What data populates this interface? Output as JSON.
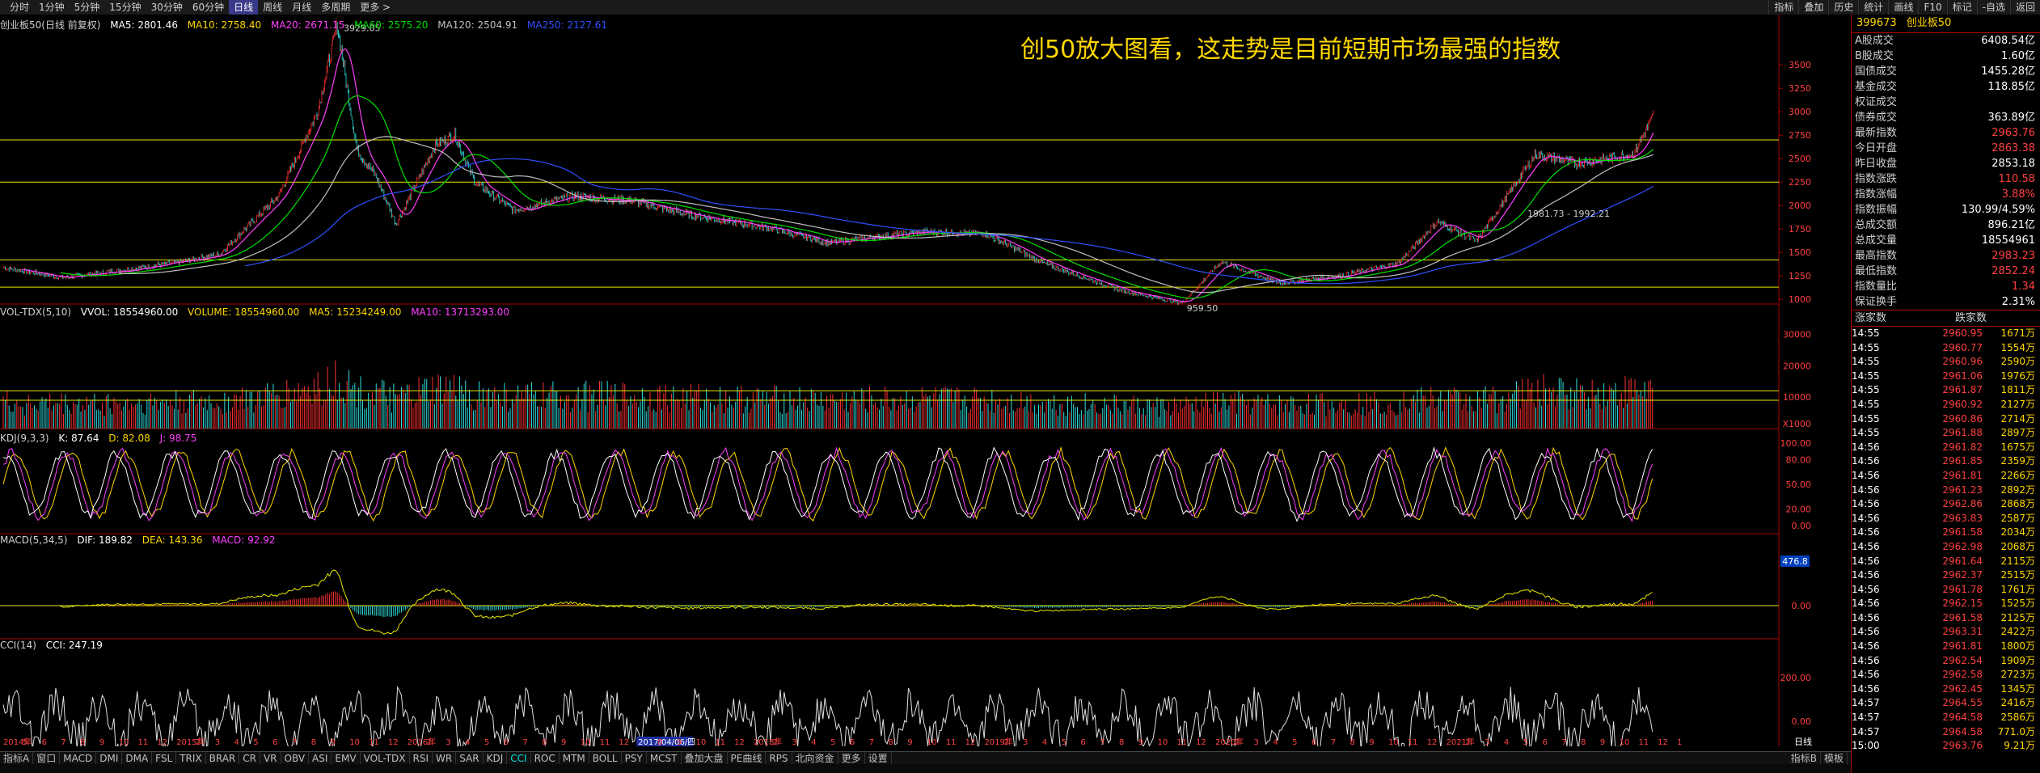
{
  "toolbar": {
    "items": [
      "分时",
      "1分钟",
      "5分钟",
      "15分钟",
      "30分钟",
      "60分钟",
      "日线",
      "周线",
      "月线",
      "多周期",
      "更多 >"
    ],
    "active": "日线",
    "right_items": [
      "指标",
      "叠加",
      "历史",
      "统计",
      "画线",
      "F10",
      "标记",
      "-自选",
      "返回"
    ]
  },
  "main_legend": {
    "name": "创业板50(日线 前复权)",
    "ma5": "MA5: 2801.46",
    "ma10": "MA10: 2758.40",
    "ma20": "MA20: 2671.15",
    "ma60": "MA60: 2575.20",
    "ma120": "MA120: 2504.91",
    "ma250": "MA250: 2127.61"
  },
  "overlay_title": "创50放大图看，这走势是目前短期市场最强的指数",
  "annotations": {
    "peak": "3929.05",
    "low": "959.50",
    "range": "1981.73 - 1992.21"
  },
  "vol_legend": {
    "name": "VOL-TDX(5,10)",
    "vvol": "VVOL: 18554960.00",
    "volume": "VOLUME: 18554960.00",
    "ma5": "MA5: 15234249.00",
    "ma10": "MA10: 13713293.00",
    "unit": "X1000"
  },
  "kdj_legend": {
    "name": "KDJ(9,3,3)",
    "k": "K: 87.64",
    "d": "D: 82.08",
    "j": "J: 98.75"
  },
  "macd_legend": {
    "name": "MACD(5,34,5)",
    "dif": "DIF: 189.82",
    "dea": "DEA: 143.36",
    "macd": "MACD: 92.92",
    "current": "476.8"
  },
  "cci_legend": {
    "name": "CCI(14)",
    "cci": "CCI: 247.19"
  },
  "axes": {
    "price_ticks": [
      "3500",
      "3250",
      "3000",
      "2750",
      "2500",
      "2250",
      "2000",
      "1750",
      "1500",
      "1250",
      "1000"
    ],
    "vol_ticks": [
      "30000",
      "20000",
      "10000"
    ],
    "kdj_ticks": [
      "100.00",
      "80.00",
      "50.00",
      "20.00",
      "0.00"
    ],
    "macd_ticks": [
      "0.00"
    ],
    "cci_ticks": [
      "200.00",
      "0.00"
    ],
    "date_labels": [
      "2014年",
      "5",
      "6",
      "7",
      "8",
      "9",
      "10",
      "11",
      "12",
      "2015年",
      "2",
      "3",
      "4",
      "5",
      "6",
      "7",
      "8",
      "9",
      "10",
      "11",
      "12",
      "2016年",
      "2",
      "3",
      "4",
      "5",
      "6",
      "7",
      "8",
      "9",
      "10",
      "11",
      "12",
      "2017/04/06/四",
      "8",
      "9",
      "10",
      "11",
      "12",
      "2018年",
      "2",
      "3",
      "4",
      "5",
      "6",
      "7",
      "8",
      "9",
      "10",
      "11",
      "12",
      "2019年",
      "2",
      "3",
      "4",
      "5",
      "6",
      "7",
      "8",
      "9",
      "10",
      "11",
      "12",
      "2020年",
      "2",
      "3",
      "4",
      "5",
      "6",
      "7",
      "8",
      "9",
      "10",
      "11",
      "12",
      "2021年",
      "2",
      "3",
      "4",
      "5",
      "6",
      "7",
      "8",
      "9",
      "10",
      "11",
      "12",
      "1"
    ],
    "date_right": "日线"
  },
  "bottom_tabs": [
    "指标A",
    "窗口",
    "MACD",
    "DMI",
    "DMA",
    "FSL",
    "TRIX",
    "BRAR",
    "CR",
    "VR",
    "OBV",
    "ASI",
    "EMV",
    "VOL-TDX",
    "RSI",
    "WR",
    "SAR",
    "KDJ",
    "CCI",
    "ROC",
    "MTM",
    "BOLL",
    "PSY",
    "MCST",
    "叠加大盘",
    "PE曲线",
    "RPS",
    "北向资金",
    "更多",
    "设置"
  ],
  "bottom_right": [
    "指标B",
    "模板"
  ],
  "panel": {
    "code": "399673",
    "name": "创业板50",
    "stats": [
      {
        "label": "A股成交",
        "value": "6408.54亿",
        "color": "white"
      },
      {
        "label": "B股成交",
        "value": "1.60亿",
        "color": "white"
      },
      {
        "label": "国债成交",
        "value": "1455.28亿",
        "color": "white"
      },
      {
        "label": "基金成交",
        "value": "118.85亿",
        "color": "white"
      },
      {
        "label": "权证成交",
        "value": "",
        "color": "white"
      },
      {
        "label": "债券成交",
        "value": "363.89亿",
        "color": "white"
      },
      {
        "label": "最新指数",
        "value": "2963.76",
        "color": "red"
      },
      {
        "label": "今日开盘",
        "value": "2863.38",
        "color": "red"
      },
      {
        "label": "昨日收盘",
        "value": "2853.18",
        "color": "white"
      },
      {
        "label": "指数涨跌",
        "value": "110.58",
        "color": "red"
      },
      {
        "label": "指数涨幅",
        "value": "3.88%",
        "color": "red"
      },
      {
        "label": "指数振幅",
        "value": "130.99/4.59%",
        "color": "white"
      },
      {
        "label": "总成交额",
        "value": "896.21亿",
        "color": "white"
      },
      {
        "label": "总成交量",
        "value": "18554961",
        "color": "white"
      },
      {
        "label": "最高指数",
        "value": "2983.23",
        "color": "red"
      },
      {
        "label": "最低指数",
        "value": "2852.24",
        "color": "red"
      },
      {
        "label": "指数量比",
        "value": "1.34",
        "color": "red"
      },
      {
        "label": "保证换手",
        "value": "2.31%",
        "color": "white"
      }
    ],
    "tick_headers": [
      "涨家数",
      "跌家数"
    ],
    "ticks": [
      [
        "14:55",
        "2960.95",
        "1671万"
      ],
      [
        "14:55",
        "2960.77",
        "1554万"
      ],
      [
        "14:55",
        "2960.96",
        "2590万"
      ],
      [
        "14:55",
        "2961.06",
        "1976万"
      ],
      [
        "14:55",
        "2961.87",
        "1811万"
      ],
      [
        "14:55",
        "2960.92",
        "2127万"
      ],
      [
        "14:55",
        "2960.86",
        "2714万"
      ],
      [
        "14:55",
        "2961.88",
        "2897万"
      ],
      [
        "14:56",
        "2961.82",
        "1675万"
      ],
      [
        "14:56",
        "2961.85",
        "2359万"
      ],
      [
        "14:56",
        "2961.81",
        "2266万"
      ],
      [
        "14:56",
        "2961.23",
        "2892万"
      ],
      [
        "14:56",
        "2962.86",
        "2868万"
      ],
      [
        "14:56",
        "2963.83",
        "2587万"
      ],
      [
        "14:56",
        "2961.58",
        "2034万"
      ],
      [
        "14:56",
        "2962.98",
        "2068万"
      ],
      [
        "14:56",
        "2961.64",
        "2115万"
      ],
      [
        "14:56",
        "2962.37",
        "2515万"
      ],
      [
        "14:56",
        "2961.78",
        "1761万"
      ],
      [
        "14:56",
        "2962.15",
        "1525万"
      ],
      [
        "14:56",
        "2961.58",
        "2125万"
      ],
      [
        "14:56",
        "2963.31",
        "2422万"
      ],
      [
        "14:56",
        "2961.81",
        "1800万"
      ],
      [
        "14:56",
        "2962.54",
        "1909万"
      ],
      [
        "14:56",
        "2962.58",
        "2723万"
      ],
      [
        "14:56",
        "2962.45",
        "1345万"
      ],
      [
        "14:57",
        "2964.55",
        "2416万"
      ],
      [
        "14:57",
        "2964.58",
        "2586万"
      ],
      [
        "14:57",
        "2964.58",
        "771.0万"
      ],
      [
        "15:00",
        "2963.76",
        "9.21万"
      ]
    ]
  },
  "chart_data": {
    "type": "candlestick",
    "title": "创业板50(日线 前复权)",
    "x_range": [
      "2014-01",
      "2021-01"
    ],
    "price_ylim": [
      950,
      3950
    ],
    "horizontal_levels": [
      2700,
      2250,
      1420,
      1130
    ],
    "series": [
      {
        "name": "close",
        "points": [
          [
            "2014-01",
            1340
          ],
          [
            "2014-04",
            1230
          ],
          [
            "2014-07",
            1310
          ],
          [
            "2014-10",
            1400
          ],
          [
            "2014-12",
            1480
          ],
          [
            "2015-03",
            2100
          ],
          [
            "2015-05",
            3000
          ],
          [
            "2015-06",
            3929
          ],
          [
            "2015-07",
            2600
          ],
          [
            "2015-08",
            2300
          ],
          [
            "2015-09",
            1800
          ],
          [
            "2015-11",
            2650
          ],
          [
            "2015-12",
            2750
          ],
          [
            "2016-01",
            2250
          ],
          [
            "2016-03",
            1950
          ],
          [
            "2016-06",
            2100
          ],
          [
            "2016-09",
            2050
          ],
          [
            "2016-12",
            1900
          ],
          [
            "2017-04",
            1760
          ],
          [
            "2017-07",
            1600
          ],
          [
            "2017-10",
            1680
          ],
          [
            "2017-12",
            1720
          ],
          [
            "2018-03",
            1700
          ],
          [
            "2018-06",
            1380
          ],
          [
            "2018-10",
            1090
          ],
          [
            "2019-01",
            959.5
          ],
          [
            "2019-03",
            1400
          ],
          [
            "2019-06",
            1170
          ],
          [
            "2019-09",
            1250
          ],
          [
            "2019-12",
            1380
          ],
          [
            "2020-02",
            1830
          ],
          [
            "2020-04",
            1620
          ],
          [
            "2020-07",
            2550
          ],
          [
            "2020-09",
            2450
          ],
          [
            "2020-12",
            2550
          ],
          [
            "2021-01",
            2963.76
          ]
        ]
      }
    ],
    "annotations": [
      "3929.05",
      "959.50",
      "1981.73 - 1992.21"
    ]
  }
}
